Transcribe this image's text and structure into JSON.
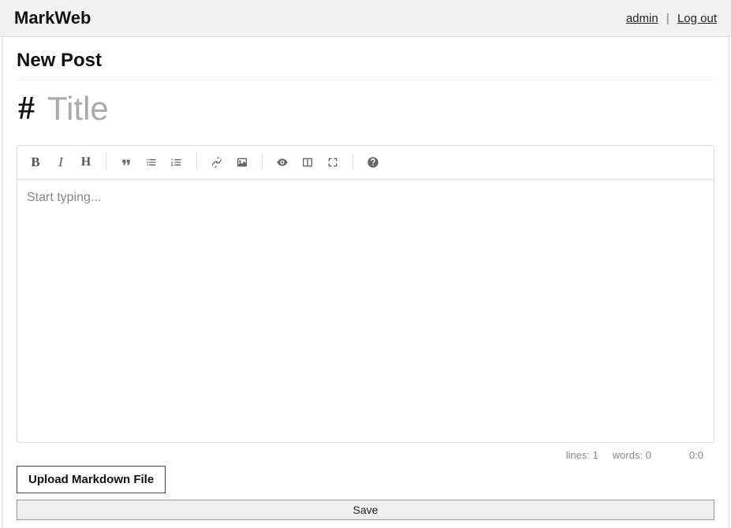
{
  "header": {
    "brand": "MarkWeb",
    "user_link": "admin",
    "logout_link": "Log out"
  },
  "page": {
    "heading": "New Post",
    "hash_symbol": "#",
    "title_placeholder": "Title",
    "title_value": ""
  },
  "toolbar": {
    "bold": "B",
    "italic": "I",
    "heading": "H"
  },
  "editor": {
    "placeholder": "Start typing...",
    "value": ""
  },
  "status": {
    "lines_label": "lines: 1",
    "words_label": "words: 0",
    "cursor": "0:0"
  },
  "buttons": {
    "upload": "Upload Markdown File",
    "save": "Save"
  }
}
